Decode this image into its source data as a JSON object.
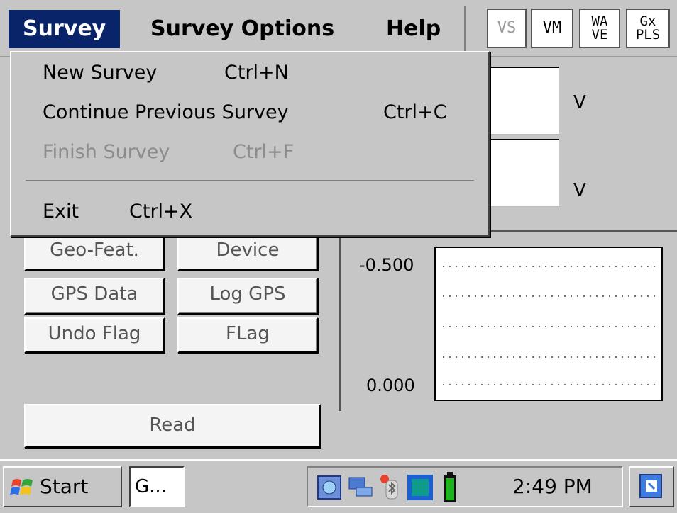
{
  "menubar": {
    "survey": "Survey",
    "survey_options": "Survey Options",
    "help": "Help",
    "tools": [
      "VS",
      "VM",
      "WA\nVE",
      "Gx\nPLS"
    ]
  },
  "dropdown": {
    "items": [
      {
        "label": "New Survey",
        "shortcut": "Ctrl+N",
        "enabled": true
      },
      {
        "label": "Continue Previous Survey",
        "shortcut": "Ctrl+C",
        "enabled": true
      },
      {
        "label": "Finish Survey",
        "shortcut": "Ctrl+F",
        "enabled": false
      },
      {
        "label": "Exit",
        "shortcut": "Ctrl+X",
        "enabled": true
      }
    ]
  },
  "readouts": {
    "unit1": "V",
    "unit2": "V"
  },
  "buttons": {
    "geo_feat": "Geo-Feat.",
    "device": "Device",
    "gps_data": "GPS Data",
    "log_gps": "Log GPS",
    "undo_flag": "Undo Flag",
    "flag": "FLag",
    "read": "Read"
  },
  "chart_data": {
    "type": "line",
    "yticks": [
      "-0.500",
      "0.000"
    ],
    "ylim": [
      -0.5,
      0.0
    ],
    "grid": "dotted horizontal",
    "series": []
  },
  "taskbar": {
    "start": "Start",
    "task": "G...",
    "clock": "2:49 PM"
  },
  "colors": {
    "menu_highlight": "#0a246a",
    "panel_bg": "#c6c6c6",
    "battery": "#1db31d"
  }
}
